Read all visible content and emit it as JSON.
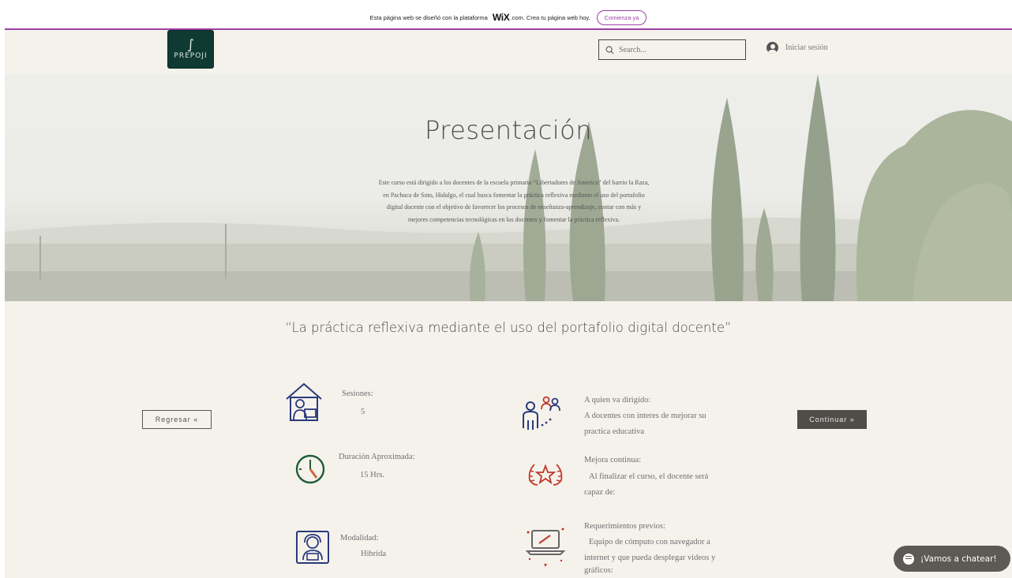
{
  "wix_banner": {
    "text_before": "Esta página web se diseñó con la plataforma",
    "logo": "WiX",
    "text_after": ".com. Crea tu página web hoy.",
    "cta_label": "Comienza ya"
  },
  "header": {
    "logo_mark": "∫",
    "logo_text": "PREPOJI",
    "search_placeholder": "Search...",
    "login_label": "Iniciar sesión"
  },
  "hero": {
    "title": "Presentación",
    "text": "Este curso está dirigido a los docentes de la escuela primaria “Libertadores de America” del barrio la Raza, en Pachuca de Soto, Hidalgo, el cual busca fomentar la práctica reflexiva mediante el uso del portafolio digital docente con el objetivo de favorecer los procesos de enseñanza-aprendizaje, contar con más y mejores competencias tecnológicas en los docentes y fomentar la práctica reflexiva."
  },
  "main": {
    "quote": "“La práctica reflexiva mediante el uso del portafolio digital docente”",
    "back_label": "Regresar «",
    "next_label": "Continuar »",
    "sessions_label": "Sesiones:",
    "sessions_value": "5",
    "duration_label": "Duración Aproximada:",
    "duration_value": "15 Hrs.",
    "modality_label": "Modalidad:",
    "modality_value": "Hibrida",
    "audience_label": "A quien va dirigido:",
    "audience_value_1": "A docentes con interes de mejorar su",
    "audience_value_2": "practica educativa",
    "improvement_label": "Mejora continua:",
    "improvement_value_1": "Al finalizar el curso, el docente será",
    "improvement_value_2": "capaz de:",
    "requirements_label": "Requerimientos previos:",
    "requirements_value_1": "Equipo de cómputo con navegador a",
    "requirements_value_2": "internet y que pueda desplegar videos y",
    "requirements_value_3": "gráficos:"
  },
  "chat": {
    "label": "¡Vamos a chatear!"
  },
  "colors": {
    "wix_accent": "#9b3fa5",
    "logo_bg": "#0f3a33",
    "page_bg": "#f5f2ec",
    "dark_button": "#4f4d48",
    "icon_navy": "#2a3a7a",
    "icon_red": "#c0392b",
    "icon_green": "#1f5d3a"
  }
}
